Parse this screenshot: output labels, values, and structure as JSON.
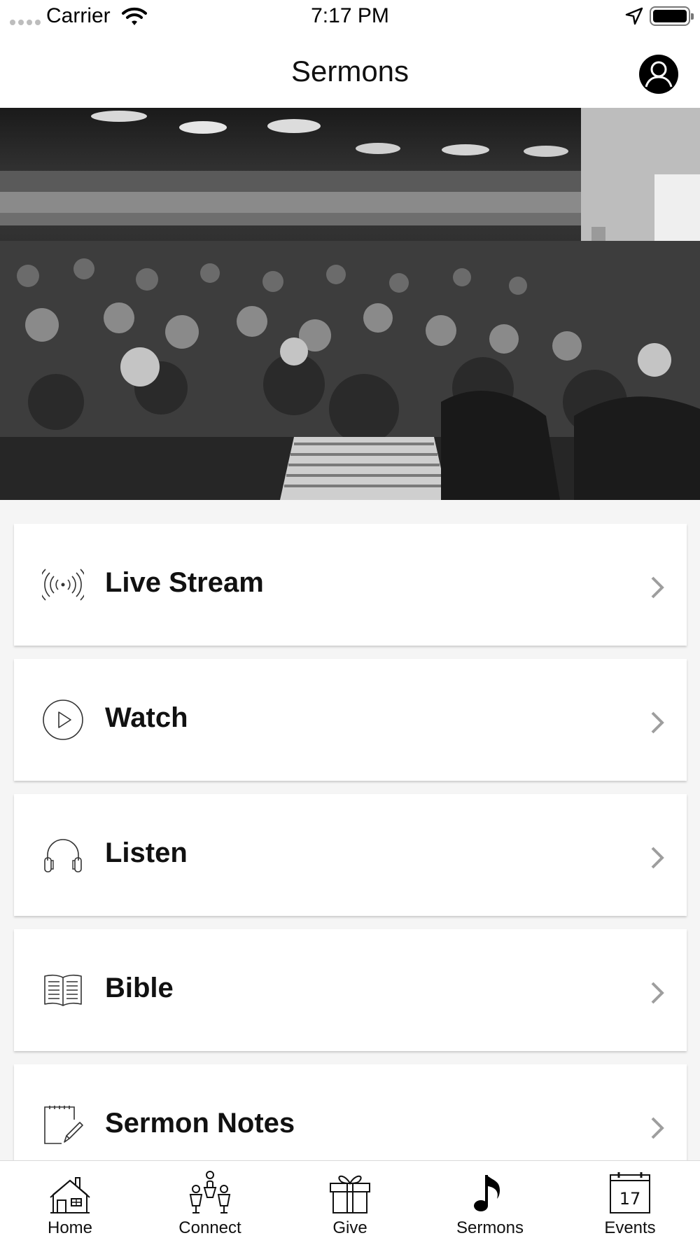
{
  "status_bar": {
    "carrier": "Carrier",
    "time": "7:17 PM"
  },
  "nav": {
    "title": "Sermons"
  },
  "hero": {
    "icon": "church-crowd-photo"
  },
  "menu": {
    "items": [
      {
        "label": "Live Stream",
        "icon": "broadcast-icon"
      },
      {
        "label": "Watch",
        "icon": "play-circle-icon"
      },
      {
        "label": "Listen",
        "icon": "headphones-icon"
      },
      {
        "label": "Bible",
        "icon": "open-book-icon"
      },
      {
        "label": "Sermon Notes",
        "icon": "notepad-pencil-icon"
      }
    ]
  },
  "tab_bar": {
    "active": "Sermons",
    "tabs": [
      {
        "label": "Home",
        "icon": "house-icon"
      },
      {
        "label": "Connect",
        "icon": "people-icon"
      },
      {
        "label": "Give",
        "icon": "gift-icon"
      },
      {
        "label": "Sermons",
        "icon": "music-note-icon"
      },
      {
        "label": "Events",
        "icon": "calendar-icon",
        "day": "17"
      }
    ]
  },
  "colors": {
    "background": "#f5f5f5",
    "card": "#ffffff",
    "text": "#111111",
    "chevron": "#9e9e9e"
  }
}
